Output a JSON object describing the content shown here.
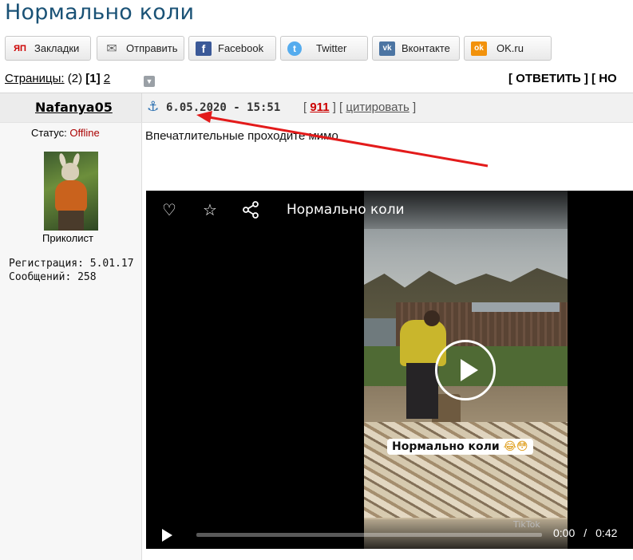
{
  "page": {
    "title": "Нормально коли"
  },
  "share_buttons": [
    {
      "label": "Закладки",
      "icon": "yandex-bookmarks-icon",
      "icon_text": "ЯП",
      "color": "#cc0000",
      "bg": "#ffffff"
    },
    {
      "label": "Отправить",
      "icon": "mail-icon",
      "icon_text": "✉",
      "color": "#666666",
      "bg": "#ffffff"
    },
    {
      "label": "Facebook",
      "icon": "facebook-icon",
      "icon_text": "f",
      "color": "#ffffff",
      "bg": "#3b5998"
    },
    {
      "label": "Twitter",
      "icon": "twitter-icon",
      "icon_text": "t",
      "color": "#ffffff",
      "bg": "#55acee"
    },
    {
      "label": "Вконтакте",
      "icon": "vk-icon",
      "icon_text": "vk",
      "color": "#ffffff",
      "bg": "#4c75a3"
    },
    {
      "label": "OK.ru",
      "icon": "odnoklassniki-icon",
      "icon_text": "ok",
      "color": "#ffffff",
      "bg": "#f2920b"
    }
  ],
  "pagination": {
    "label": "Страницы:",
    "total": "(2)",
    "current": "[1]",
    "next": "2"
  },
  "actions": {
    "reply": "[ ОТВЕТИТЬ ] [ НО"
  },
  "post": {
    "author": "Nafanya05",
    "date": "6.05.2020 - 15:51",
    "number": "911",
    "quote": "цитировать",
    "text": "Впечатлительные проходите мимо"
  },
  "user": {
    "status_label": "Статус:",
    "status_value": "Offline",
    "rank": "Приколист",
    "registration": "Регистрация: 5.01.17",
    "messages": "Сообщений: 258"
  },
  "video": {
    "title": "Нормально коли",
    "caption": "Нормально коли",
    "caption_emoji": "😂😳",
    "current_time": "0:00",
    "duration": "0:42",
    "progress": 0,
    "watermark": "TikTok"
  },
  "colors": {
    "accent": "#1a5276",
    "arrow": "#e31b1b",
    "offline": "#aa0000",
    "post_number": "#cc0000"
  }
}
